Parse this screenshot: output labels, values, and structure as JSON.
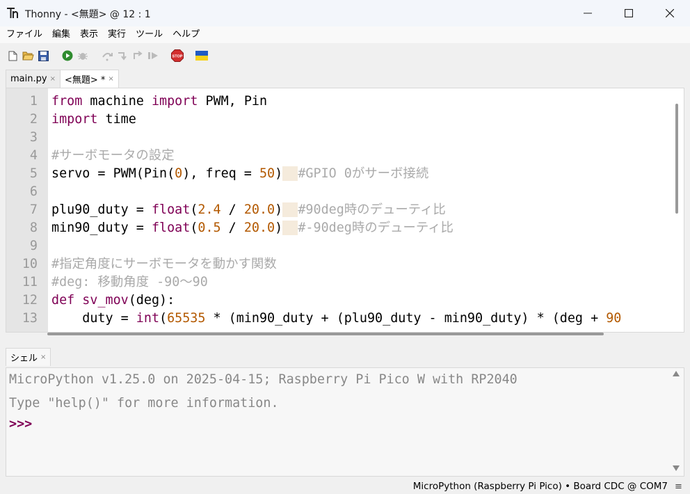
{
  "window": {
    "title": "Thonny  -  <無題>  @  12 : 1"
  },
  "menu": [
    "ファイル",
    "編集",
    "表示",
    "実行",
    "ツール",
    "ヘルプ"
  ],
  "editor_tabs": [
    {
      "label": "main.py",
      "close": "×"
    },
    {
      "label": "<無題> *",
      "close": "×"
    }
  ],
  "editor": {
    "line_numbers": [
      "1",
      "2",
      "3",
      "4",
      "5",
      "6",
      "7",
      "8",
      "9",
      "10",
      "11",
      "12",
      "13"
    ],
    "tokens": {
      "l1_from": "from",
      "l1_mid1": " machine ",
      "l1_import": "import",
      "l1_rest": " PWM, Pin",
      "l2_import": "import",
      "l2_rest": " time",
      "l4_cmt": "#サーボモータの設定",
      "l5_a": "servo = PWM(Pin(",
      "l5_n0": "0",
      "l5_b": "), freq = ",
      "l5_n50": "50",
      "l5_c": ")",
      "l5_pad": "  ",
      "l5_cmt": "#GPIO 0がサーボ接続",
      "l7_a": "plu90_duty = ",
      "l7_float": "float",
      "l7_b": "(",
      "l7_n1": "2.4",
      "l7_c": " / ",
      "l7_n2": "20.0",
      "l7_d": ")",
      "l7_pad": "  ",
      "l7_cmt": "#90deg時のデューティ比",
      "l8_a": "min90_duty = ",
      "l8_float": "float",
      "l8_b": "(",
      "l8_n1": "0.5",
      "l8_c": " / ",
      "l8_n2": "20.0",
      "l8_d": ")",
      "l8_pad": "  ",
      "l8_cmt": "#-90deg時のデューティ比",
      "l10_cmt": "#指定角度にサーボモータを動かす関数",
      "l11_cmt": "#deg: 移動角度 -90〜90",
      "l12_def": "def",
      "l12_sp": " ",
      "l12_name": "sv_mov",
      "l12_rest": "(deg):",
      "l13_a": "    duty = ",
      "l13_int": "int",
      "l13_b": "(",
      "l13_n": "65535",
      "l13_c": " * (min90_duty + (plu90_duty - min90_duty) * (deg + ",
      "l13_n2": "90"
    }
  },
  "shell": {
    "tab_label": "シェル",
    "tab_close": "×",
    "line1": "MicroPython v1.25.0 on 2025-04-15; Raspberry Pi Pico W with RP2040",
    "line2": "Type \"help()\" for more information.",
    "prompt": ">>>"
  },
  "status": {
    "text": "MicroPython (Raspberry Pi Pico)  •  Board CDC @ COM7",
    "menu_icon": "≡"
  },
  "icons": [
    "thonny-app-icon",
    "minimize-icon",
    "maximize-icon",
    "close-icon",
    "new-file-icon",
    "open-file-icon",
    "save-icon",
    "run-icon",
    "debug-icon",
    "step-over-icon",
    "step-into-icon",
    "step-out-icon",
    "resume-icon",
    "stop-icon",
    "ukraine-flag-icon"
  ],
  "colors": {
    "keyword": "#7f0055",
    "number": "#b35900",
    "comment": "#aaaaaa",
    "stop": "#d32f2f",
    "run": "#2e8b2e"
  }
}
